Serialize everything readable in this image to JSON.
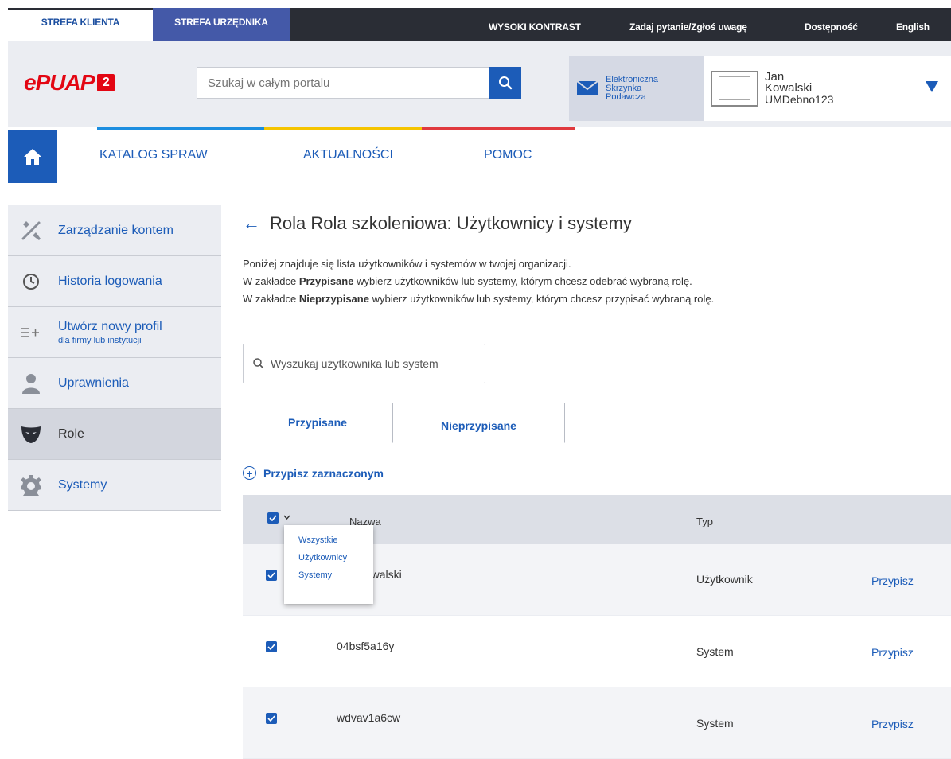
{
  "topbar": {
    "zone_client": "STREFA KLIENTA",
    "zone_official": "STREFA URZĘDNIKA",
    "high_contrast": "WYSOKI KONTRAST",
    "ask_question": "Zadaj pytanie/Zgłoś uwagę",
    "accessibility": "Dostępność",
    "language": "English"
  },
  "header": {
    "logo_text": "ePUAP",
    "logo_badge": "2",
    "search_placeholder": "Szukaj w całym portalu",
    "esp_line1": "Elektroniczna",
    "esp_line2": "Skrzynka",
    "esp_line3": "Podawcza",
    "user_first": "Jan",
    "user_last": "Kowalski",
    "user_org": "UMDebno123"
  },
  "nav": {
    "items": [
      "KATALOG SPRAW",
      "AKTUALNOŚCI",
      "POMOC"
    ]
  },
  "sidebar": {
    "items": [
      {
        "label": "Zarządzanie kontem"
      },
      {
        "label": "Historia logowania"
      },
      {
        "label": "Utwórz nowy profil",
        "sub": "dla firmy lub instytucji"
      },
      {
        "label": "Uprawnienia"
      },
      {
        "label": "Role"
      },
      {
        "label": "Systemy"
      }
    ]
  },
  "main": {
    "title": "Rola Rola szkoleniowa: Użytkownicy i systemy",
    "desc_line1": "Poniżej znajduje się lista użytkowników i systemów w twojej organizacji.",
    "desc_line2_pre": "W zakładce ",
    "desc_line2_bold": "Przypisane",
    "desc_line2_post": " wybierz użytkowników lub systemy, którym chcesz odebrać wybraną rolę.",
    "desc_line3_pre": "W zakładce ",
    "desc_line3_bold": "Nieprzypisane",
    "desc_line3_post": " wybierz użytkowników lub systemy, którym chcesz przypisać wybraną rolę.",
    "user_search_placeholder": "Wyszukaj użytkownika lub system",
    "tab_assigned": "Przypisane",
    "tab_unassigned": "Nieprzypisane",
    "assign_selected": "Przypisz zaznaczonym",
    "col_name": "Nazwa",
    "col_type": "Typ",
    "rows": [
      {
        "name": "Jan Kowalski",
        "type": "Użytkownik",
        "action": "Przypisz"
      },
      {
        "name": "04bsf5a16y",
        "type": "System",
        "action": "Przypisz"
      },
      {
        "name": "wdvav1a6cw",
        "type": "System",
        "action": "Przypisz"
      }
    ],
    "select_menu": [
      "Wszystkie",
      "Użytkownicy",
      "Systemy"
    ]
  },
  "colors": {
    "brand_blue": "#1c5cb8",
    "topbar_dark": "#2a2d35",
    "official_zone": "#4459a8",
    "logo_red": "#e30613"
  },
  "icons": {
    "search": "search-icon",
    "envelope": "envelope-icon",
    "dropdown": "triangle-down-icon",
    "home": "home-icon",
    "tools": "tools-icon",
    "clock": "clock-icon",
    "add_profile": "list-plus-icon",
    "person": "person-icon",
    "mask": "mask-icon",
    "gear": "gear-icon",
    "arrow_back": "arrow-left-icon",
    "plus_circle": "plus-circle-icon",
    "check": "checkbox-checked-icon"
  }
}
